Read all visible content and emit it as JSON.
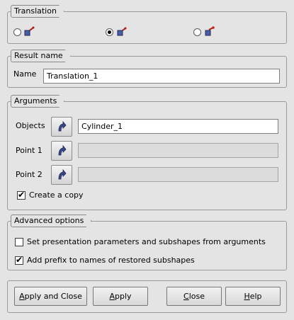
{
  "translation": {
    "title": "Translation",
    "options": [
      {
        "selected": false,
        "icon": "translation-by-vector-icon"
      },
      {
        "selected": true,
        "icon": "translation-by-dxdydz-icon"
      },
      {
        "selected": false,
        "icon": "translation-by-two-points-icon"
      }
    ]
  },
  "result": {
    "title": "Result name",
    "name_label": "Name",
    "name_value": "Translation_1"
  },
  "arguments": {
    "title": "Arguments",
    "objects_label": "Objects",
    "objects_value": "Cylinder_1",
    "point1_label": "Point 1",
    "point1_value": "",
    "point2_label": "Point 2",
    "point2_value": "",
    "create_copy_label": "Create a copy",
    "create_copy_checked": true
  },
  "advanced": {
    "title": "Advanced options",
    "presentation_label": "Set presentation parameters and subshapes from arguments",
    "presentation_checked": false,
    "prefix_label": "Add prefix to names of restored subshapes",
    "prefix_checked": true
  },
  "buttons": {
    "apply_close_u": "A",
    "apply_close_rest": "pply and Close",
    "apply_u": "A",
    "apply_rest": "pply",
    "close_u": "C",
    "close_rest": "lose",
    "help_u": "H",
    "help_rest": "elp"
  },
  "colors": {
    "background": "#e4e4e4",
    "arrow_icon": "#3a4a8c"
  }
}
